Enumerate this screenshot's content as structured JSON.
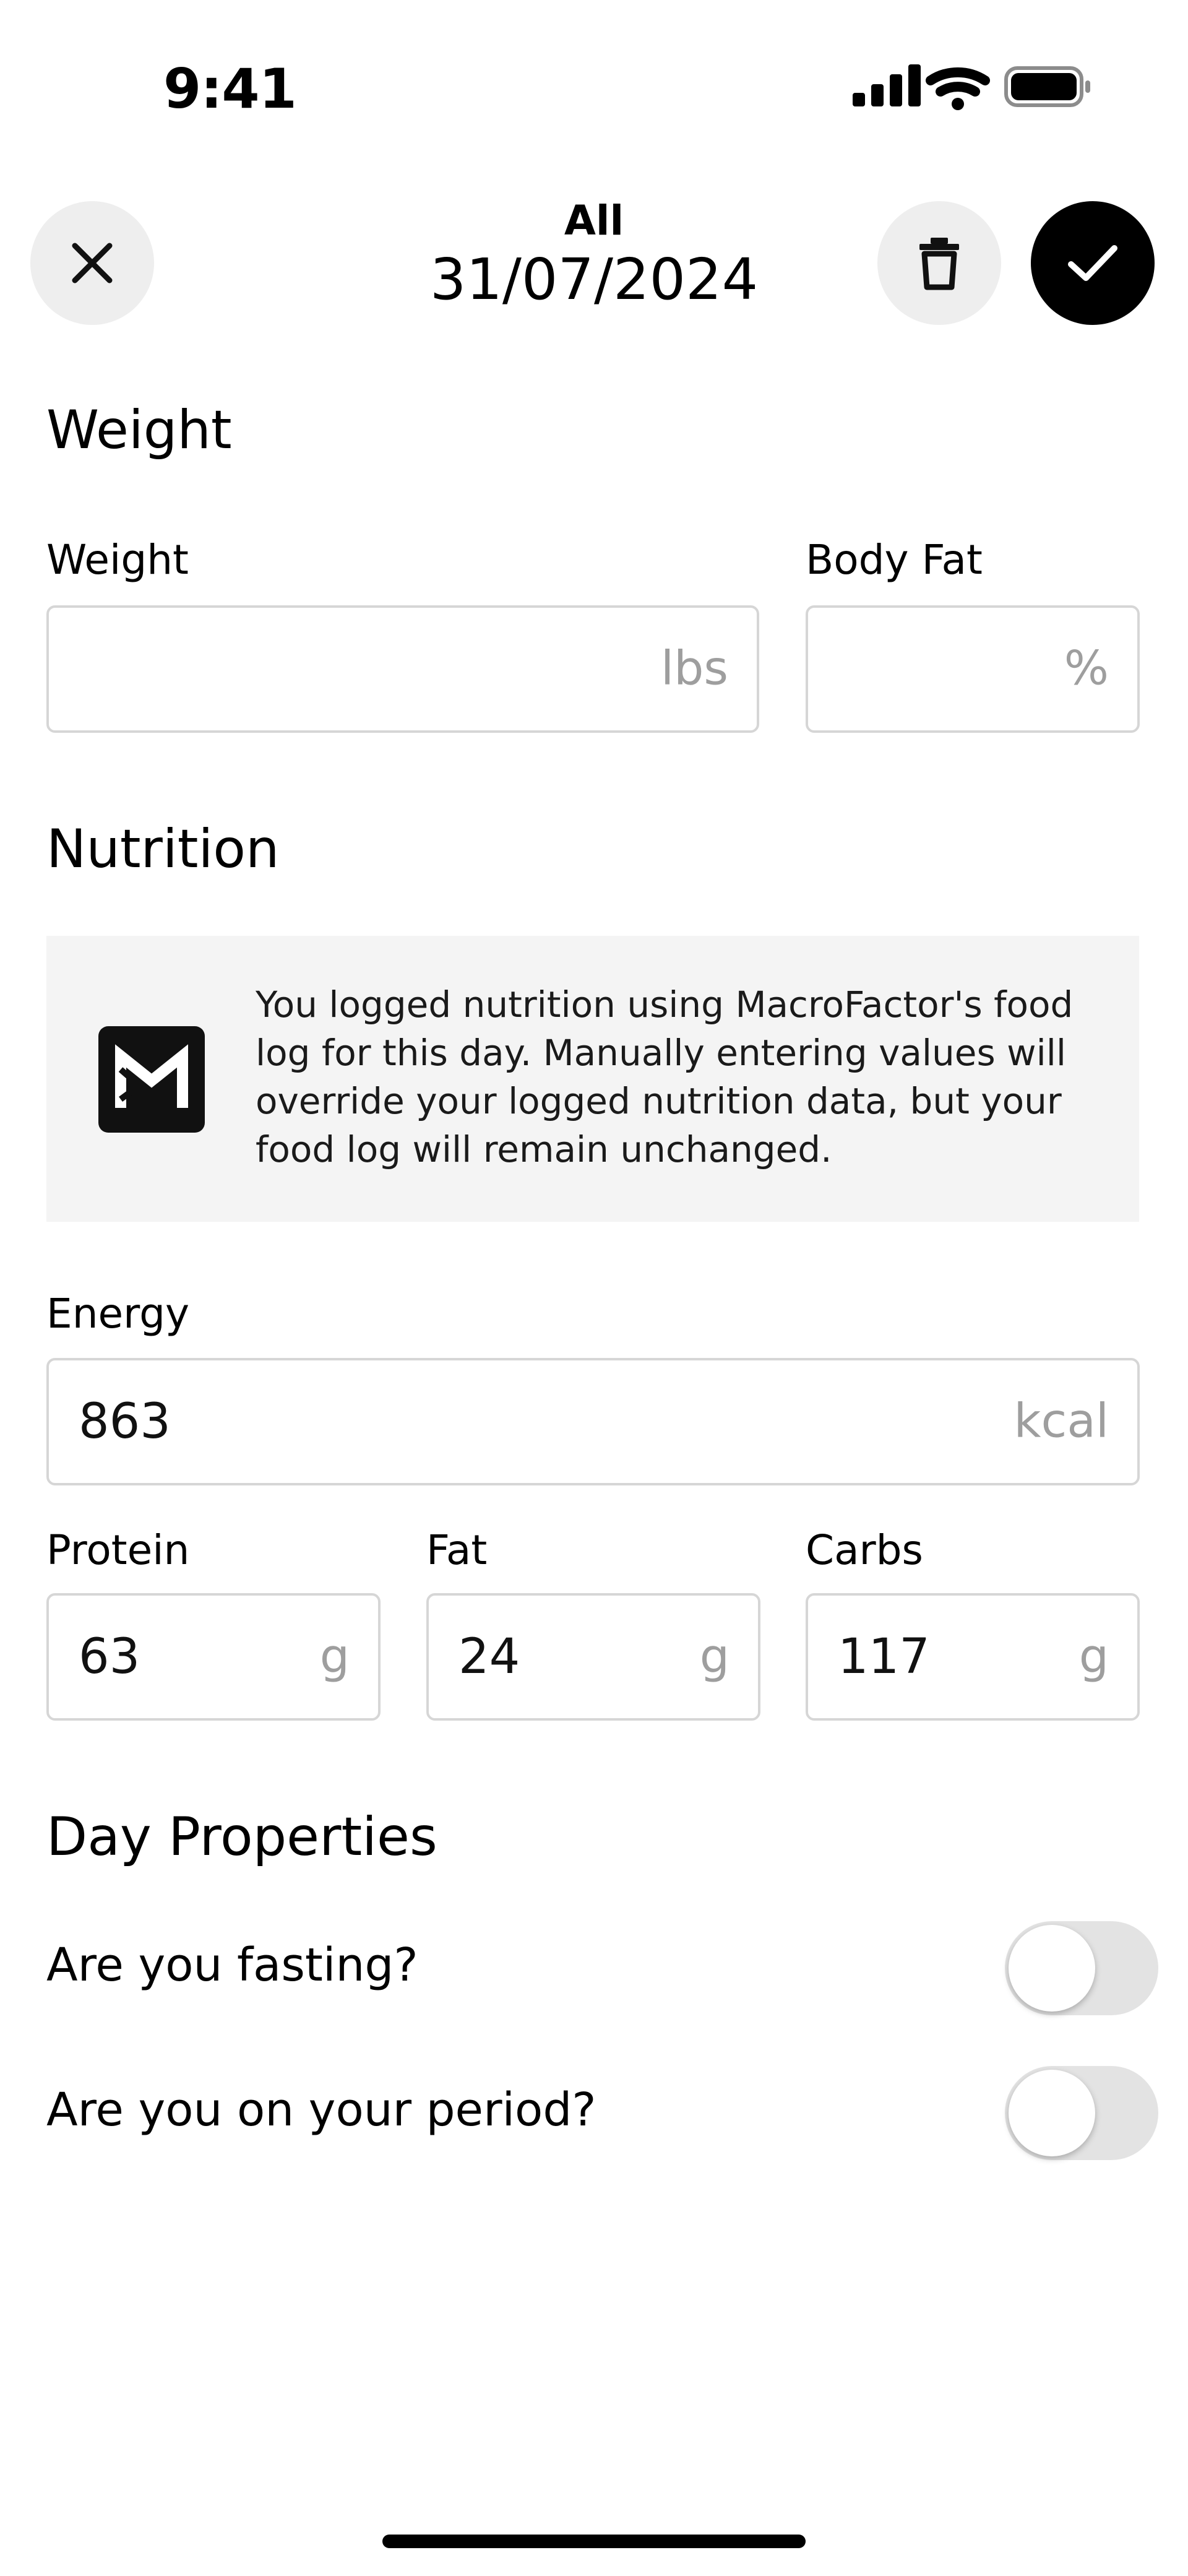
{
  "status_bar": {
    "time": "9:41",
    "icons": [
      "cellular-signal-icon",
      "wifi-icon",
      "battery-icon"
    ]
  },
  "header": {
    "subtitle": "All",
    "date": "31/07/2024",
    "close_icon": "close-icon",
    "delete_icon": "trash-icon",
    "confirm_icon": "checkmark-icon"
  },
  "weight_section": {
    "title": "Weight",
    "weight": {
      "label": "Weight",
      "value": "",
      "unit": "lbs"
    },
    "body_fat": {
      "label": "Body Fat",
      "value": "",
      "unit": "%"
    }
  },
  "nutrition_section": {
    "title": "Nutrition",
    "info_text": "You logged nutrition using MacroFactor's food log for this day. Manually entering values will override your logged nutrition data, but your food log will remain unchanged.",
    "logo_icon": "macrofactor-logo-icon",
    "energy": {
      "label": "Energy",
      "value": "863",
      "unit": "kcal"
    },
    "protein": {
      "label": "Protein",
      "value": "63",
      "unit": "g"
    },
    "fat": {
      "label": "Fat",
      "value": "24",
      "unit": "g"
    },
    "carbs": {
      "label": "Carbs",
      "value": "117",
      "unit": "g"
    }
  },
  "day_properties": {
    "title": "Day Properties",
    "fasting": {
      "label": "Are you fasting?",
      "on": false
    },
    "period": {
      "label": "Are you on your period?",
      "on": false
    }
  },
  "colors": {
    "accent": "#000000",
    "button_bg": "#eeeeee",
    "input_border": "#d6d6d6",
    "info_bg": "#f4f4f4",
    "unit_text": "#9e9e9e",
    "toggle_off": "#e3e3e3"
  }
}
